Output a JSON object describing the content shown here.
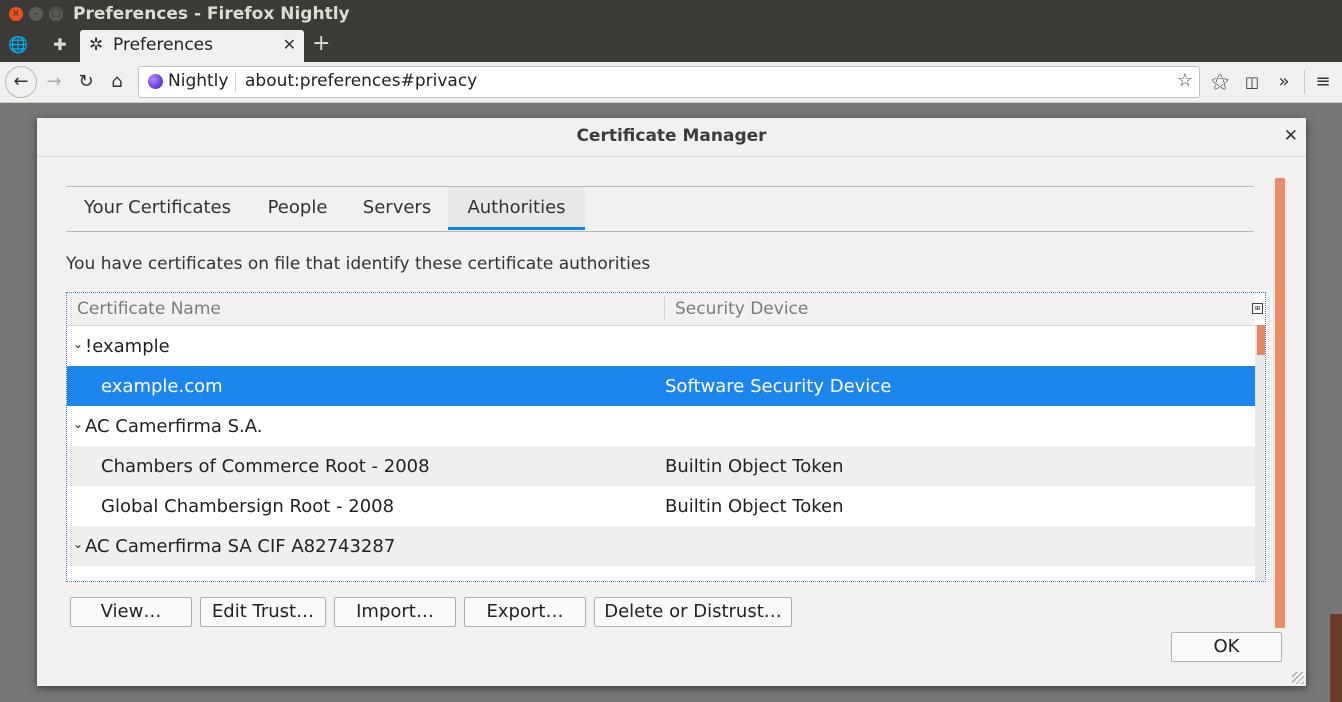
{
  "window": {
    "title": "Preferences - Firefox Nightly"
  },
  "tabstrip": {
    "tab_label": "Preferences",
    "new_tab": "+"
  },
  "navbar": {
    "identity": "Nightly",
    "url": "about:preferences#privacy"
  },
  "dialog": {
    "title": "Certificate Manager",
    "tabs": [
      "Your Certificates",
      "People",
      "Servers",
      "Authorities"
    ],
    "selected_tab": "Authorities",
    "intro": "You have certificates on file that identify these certificate authorities",
    "columns": [
      "Certificate Name",
      "Security Device"
    ],
    "rows": [
      {
        "name": "!example",
        "device": "",
        "group": true
      },
      {
        "name": "example.com",
        "device": "Software Security Device",
        "group": false,
        "selected": true
      },
      {
        "name": "AC Camerfirma S.A.",
        "device": "",
        "group": true
      },
      {
        "name": "Chambers of Commerce Root - 2008",
        "device": "Builtin Object Token",
        "group": false
      },
      {
        "name": "Global Chambersign Root - 2008",
        "device": "Builtin Object Token",
        "group": false
      },
      {
        "name": "AC Camerfirma SA CIF A82743287",
        "device": "",
        "group": true
      }
    ],
    "buttons": [
      "View…",
      "Edit Trust…",
      "Import…",
      "Export…",
      "Delete or Distrust…"
    ],
    "ok_label": "OK"
  },
  "colors": {
    "accent": "#0a84ff",
    "selection": "#1c86ee",
    "scrollbar": "#f08c64",
    "titlebar": "#3c3b37"
  }
}
